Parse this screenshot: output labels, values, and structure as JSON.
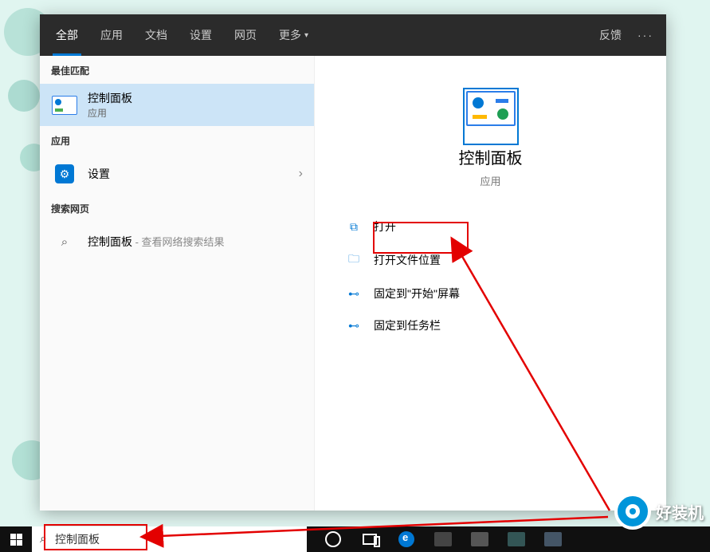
{
  "tabs": {
    "all": "全部",
    "apps": "应用",
    "docs": "文档",
    "settings": "设置",
    "web": "网页",
    "more": "更多",
    "feedback": "反馈"
  },
  "sections": {
    "best_match": "最佳匹配",
    "apps": "应用",
    "search_web": "搜索网页"
  },
  "best": {
    "title": "控制面板",
    "sub": "应用"
  },
  "apps_list": {
    "settings": "设置"
  },
  "web": {
    "query": "控制面板",
    "suffix": " - 查看网络搜索结果"
  },
  "preview": {
    "title": "控制面板",
    "sub": "应用"
  },
  "actions": {
    "open": "打开",
    "open_location": "打开文件位置",
    "pin_start": "固定到\"开始\"屏幕",
    "pin_taskbar": "固定到任务栏"
  },
  "searchbox": {
    "value": "控制面板"
  },
  "watermark": "好装机",
  "icons": {
    "chevron_down": "▾",
    "chevron_right": "›",
    "ellipsis": "···",
    "magnifier": "⌕",
    "open": "⧉",
    "folder": "🗀",
    "pin": "⊷",
    "gear": "⚙"
  }
}
